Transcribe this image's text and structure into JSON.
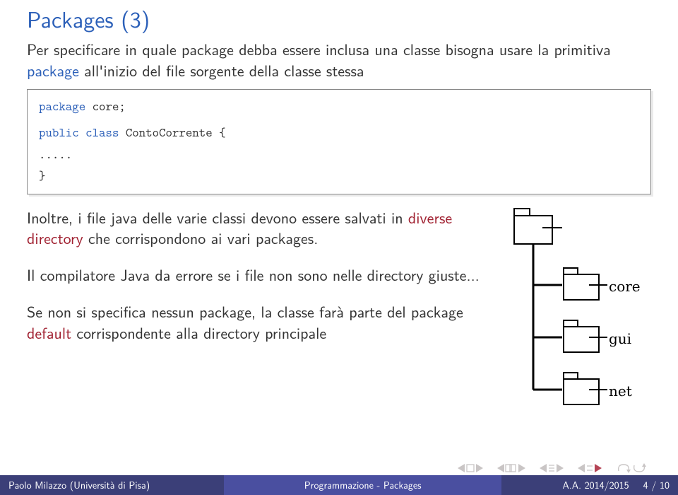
{
  "title": "Packages (3)",
  "intro": {
    "pre": "Per specificare in quale package debba essere inclusa una classe bisogna usare la primitiva ",
    "primitive": "package",
    "post": " all'inizio del file sorgente della classe stessa"
  },
  "code": {
    "k_package": "package",
    "pkg_name": "core",
    "k_public": "public",
    "k_class": "class",
    "class_name": "ContoCorrente",
    "dots": ".....",
    "brace_open": "{",
    "brace_close": "}",
    "semi": ";"
  },
  "para1": {
    "pre": "Inoltre, i file java delle varie classi devono essere salvati in ",
    "emph": "diverse directory",
    "post": " che corrispondono ai vari packages."
  },
  "para2": "Il compilatore Java da errore se i file non sono nelle directory giuste...",
  "para3": {
    "pre": "Se non si specifica nessun package, la classe farà parte del package ",
    "emph": "default",
    "post": " corrispondente alla directory principale"
  },
  "diagram": {
    "labels": [
      "core",
      "gui",
      "net"
    ]
  },
  "footer": {
    "author": "Paolo Milazzo (Università di Pisa)",
    "talk": "Programmazione - Packages",
    "term": "A.A. 2014/2015",
    "page": "4 / 10"
  }
}
